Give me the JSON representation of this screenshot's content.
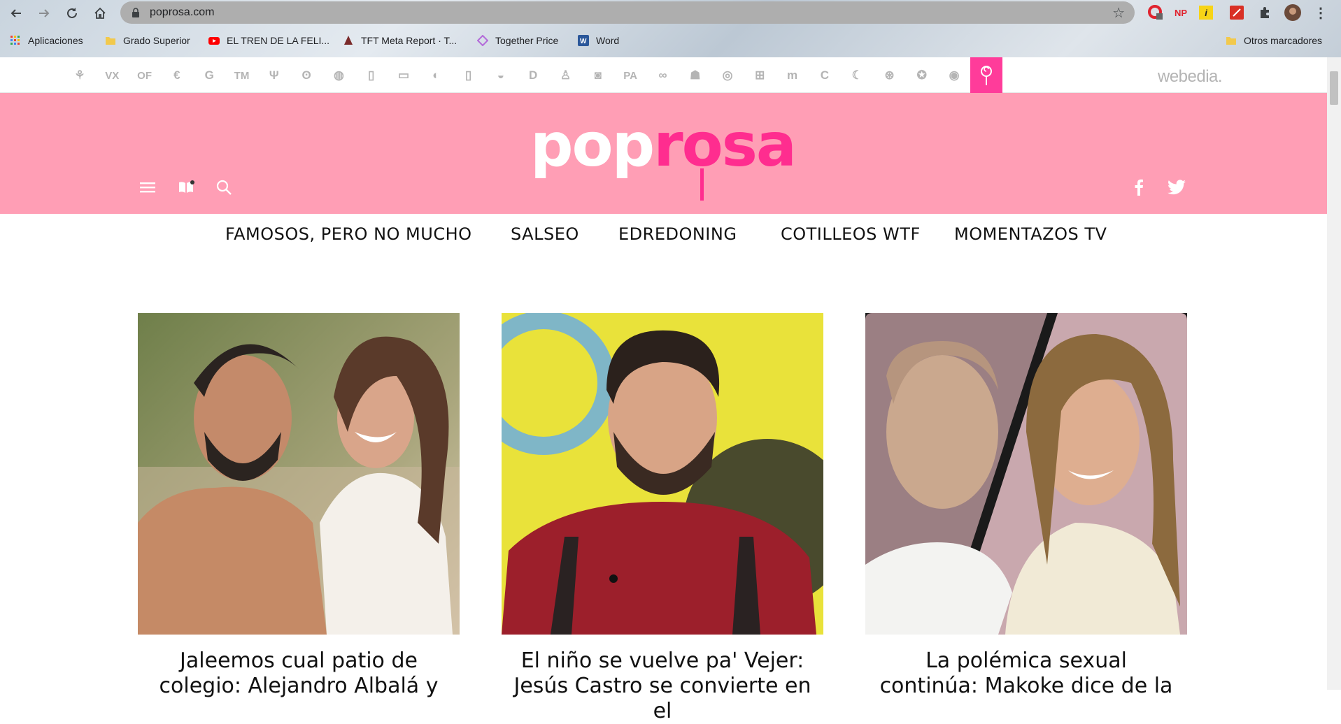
{
  "browser": {
    "url": "poprosa.com",
    "bookmarks": [
      {
        "label": "Aplicaciones",
        "icon": "apps-grid-icon"
      },
      {
        "label": "Grado Superior",
        "icon": "folder-icon"
      },
      {
        "label": "EL TREN DE LA FELI...",
        "icon": "youtube-icon"
      },
      {
        "label": "TFT Meta Report · T...",
        "icon": "tft-icon"
      },
      {
        "label": "Together Price",
        "icon": "together-price-icon"
      },
      {
        "label": "Word",
        "icon": "word-icon"
      }
    ],
    "other_bookmarks": "Otros marcadores",
    "extensions": {
      "np": "NP",
      "badge": "i"
    }
  },
  "network": {
    "icons": [
      {
        "name": "network-site-1-icon",
        "glyph": "⚘"
      },
      {
        "name": "network-site-vx-icon",
        "glyph": "VX"
      },
      {
        "name": "network-site-of-icon",
        "glyph": "OF"
      },
      {
        "name": "network-site-euro-icon",
        "glyph": "€"
      },
      {
        "name": "network-site-g-icon",
        "glyph": "G"
      },
      {
        "name": "network-site-tm-icon",
        "glyph": "TM"
      },
      {
        "name": "network-site-cutlery-icon",
        "glyph": "Ψ"
      },
      {
        "name": "network-site-bear-icon",
        "glyph": "ʘ"
      },
      {
        "name": "network-site-globe-icon",
        "glyph": "◍"
      },
      {
        "name": "network-site-tube-icon",
        "glyph": "▯"
      },
      {
        "name": "network-site-bag-icon",
        "glyph": "▭"
      },
      {
        "name": "network-site-apple-icon",
        "glyph": "◐"
      },
      {
        "name": "network-site-phone-icon",
        "glyph": "▯"
      },
      {
        "name": "network-site-car-icon",
        "glyph": "◒"
      },
      {
        "name": "network-site-d-icon",
        "glyph": "D"
      },
      {
        "name": "network-site-runner-icon",
        "glyph": "♙"
      },
      {
        "name": "network-site-camera-icon",
        "glyph": "◙"
      },
      {
        "name": "network-site-pa-icon",
        "glyph": "PA"
      },
      {
        "name": "network-site-glasses-icon",
        "glyph": "∞"
      },
      {
        "name": "network-site-android-icon",
        "glyph": "☗"
      },
      {
        "name": "network-site-ring-icon",
        "glyph": "◎"
      },
      {
        "name": "network-site-windows-icon",
        "glyph": "⊞"
      },
      {
        "name": "network-site-m-icon",
        "glyph": "m"
      },
      {
        "name": "network-site-c-icon",
        "glyph": "C"
      },
      {
        "name": "network-site-leaf-icon",
        "glyph": "☾"
      },
      {
        "name": "network-site-wheel-icon",
        "glyph": "⊛"
      },
      {
        "name": "network-site-gear-icon",
        "glyph": "✪"
      },
      {
        "name": "network-site-ball-icon",
        "glyph": "◉"
      }
    ],
    "brand": "webedia.",
    "active_color": "#ff3c9a"
  },
  "header": {
    "logo_pop": "pop",
    "logo_rosa": "rosa",
    "background": "#ff9eb5",
    "accent": "#ff2d8f"
  },
  "nav": {
    "items": [
      "FAMOSOS, PERO NO MUCHO",
      "SALSEO",
      "EDREDONING",
      "COTILLEOS WTF",
      "MOMENTAZOS TV"
    ]
  },
  "articles": [
    {
      "title": "Jaleemos cual patio de colegio: Alejandro Albalá y"
    },
    {
      "title": "El niño se vuelve pa' Vejer: Jesús Castro se convierte en el"
    },
    {
      "title": "La polémica sexual continúa: Makoke dice de la"
    }
  ]
}
